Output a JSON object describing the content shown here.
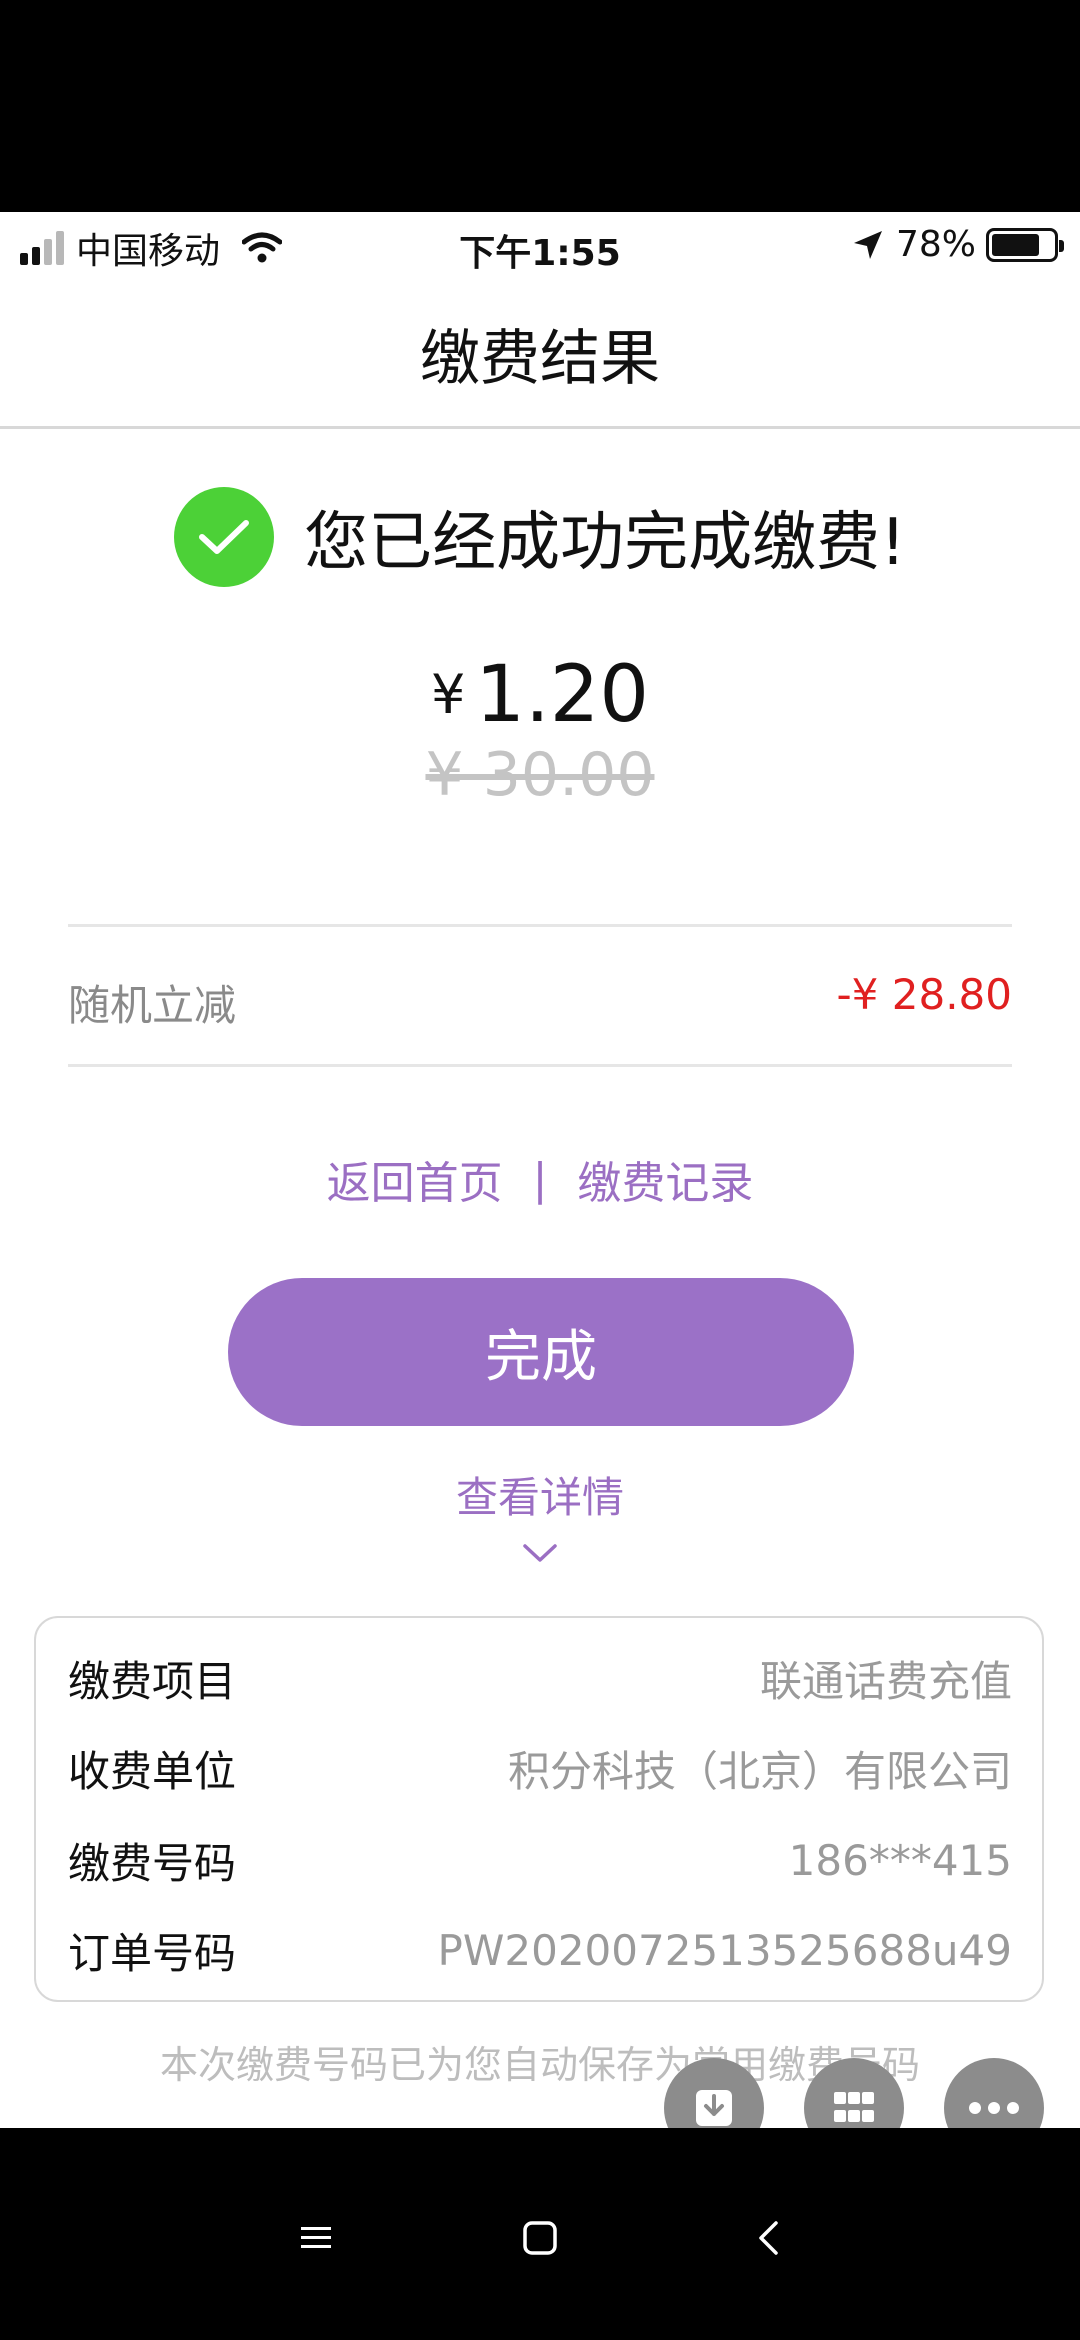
{
  "status_bar": {
    "carrier": "中国移动",
    "time": "下午1:55",
    "battery_percent": "78%",
    "battery_level": 0.78,
    "icons": [
      "signal-icon",
      "wifi-icon",
      "location-arrow-icon",
      "battery-icon"
    ]
  },
  "nav": {
    "title": "缴费结果"
  },
  "result": {
    "message": "您已经成功完成缴费!",
    "currency": "¥",
    "amount": "1.20",
    "original_amount": "¥ 30.00",
    "icon": "check-circle-icon"
  },
  "discount": {
    "label": "随机立减",
    "value": "-¥ 28.80"
  },
  "links": {
    "home": "返回首页",
    "separator": "|",
    "records": "缴费记录"
  },
  "done_button": {
    "label": "完成"
  },
  "details_toggle": {
    "label": "查看详情",
    "icon": "chevron-down-icon"
  },
  "details": {
    "rows": [
      {
        "key": "缴费项目",
        "value": "联通话费充值"
      },
      {
        "key": "收费单位",
        "value": "积分科技（北京）有限公司"
      },
      {
        "key": "缴费号码",
        "value": "186***415"
      },
      {
        "key": "订单号码",
        "value": "PW2020072513525688u49"
      }
    ]
  },
  "footer_note": "本次缴费号码已为您自动保存为常用缴费号码",
  "floating_actions": [
    "download-icon",
    "grid-icon",
    "more-icon"
  ],
  "system_nav": [
    "menu-icon",
    "home-square-icon",
    "back-icon"
  ],
  "colors": {
    "accent": "#9b71c7",
    "success": "#4cd137",
    "discount": "#e02020",
    "muted": "#9a9a9a"
  }
}
